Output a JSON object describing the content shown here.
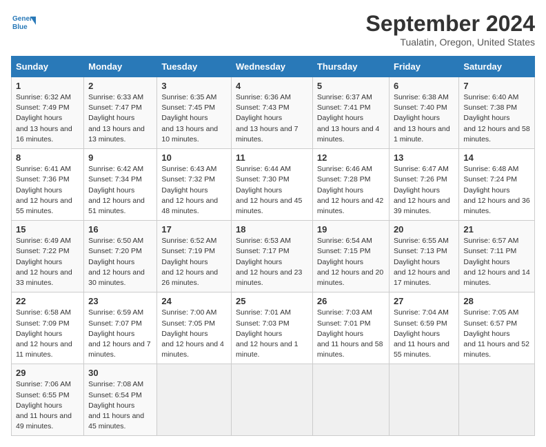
{
  "header": {
    "logo_line1": "General",
    "logo_line2": "Blue",
    "month": "September 2024",
    "location": "Tualatin, Oregon, United States"
  },
  "days_of_week": [
    "Sunday",
    "Monday",
    "Tuesday",
    "Wednesday",
    "Thursday",
    "Friday",
    "Saturday"
  ],
  "weeks": [
    [
      {
        "day": "1",
        "sunrise": "6:32 AM",
        "sunset": "7:49 PM",
        "daylight": "13 hours and 16 minutes."
      },
      {
        "day": "2",
        "sunrise": "6:33 AM",
        "sunset": "7:47 PM",
        "daylight": "13 hours and 13 minutes."
      },
      {
        "day": "3",
        "sunrise": "6:35 AM",
        "sunset": "7:45 PM",
        "daylight": "13 hours and 10 minutes."
      },
      {
        "day": "4",
        "sunrise": "6:36 AM",
        "sunset": "7:43 PM",
        "daylight": "13 hours and 7 minutes."
      },
      {
        "day": "5",
        "sunrise": "6:37 AM",
        "sunset": "7:41 PM",
        "daylight": "13 hours and 4 minutes."
      },
      {
        "day": "6",
        "sunrise": "6:38 AM",
        "sunset": "7:40 PM",
        "daylight": "13 hours and 1 minute."
      },
      {
        "day": "7",
        "sunrise": "6:40 AM",
        "sunset": "7:38 PM",
        "daylight": "12 hours and 58 minutes."
      }
    ],
    [
      {
        "day": "8",
        "sunrise": "6:41 AM",
        "sunset": "7:36 PM",
        "daylight": "12 hours and 55 minutes."
      },
      {
        "day": "9",
        "sunrise": "6:42 AM",
        "sunset": "7:34 PM",
        "daylight": "12 hours and 51 minutes."
      },
      {
        "day": "10",
        "sunrise": "6:43 AM",
        "sunset": "7:32 PM",
        "daylight": "12 hours and 48 minutes."
      },
      {
        "day": "11",
        "sunrise": "6:44 AM",
        "sunset": "7:30 PM",
        "daylight": "12 hours and 45 minutes."
      },
      {
        "day": "12",
        "sunrise": "6:46 AM",
        "sunset": "7:28 PM",
        "daylight": "12 hours and 42 minutes."
      },
      {
        "day": "13",
        "sunrise": "6:47 AM",
        "sunset": "7:26 PM",
        "daylight": "12 hours and 39 minutes."
      },
      {
        "day": "14",
        "sunrise": "6:48 AM",
        "sunset": "7:24 PM",
        "daylight": "12 hours and 36 minutes."
      }
    ],
    [
      {
        "day": "15",
        "sunrise": "6:49 AM",
        "sunset": "7:22 PM",
        "daylight": "12 hours and 33 minutes."
      },
      {
        "day": "16",
        "sunrise": "6:50 AM",
        "sunset": "7:20 PM",
        "daylight": "12 hours and 30 minutes."
      },
      {
        "day": "17",
        "sunrise": "6:52 AM",
        "sunset": "7:19 PM",
        "daylight": "12 hours and 26 minutes."
      },
      {
        "day": "18",
        "sunrise": "6:53 AM",
        "sunset": "7:17 PM",
        "daylight": "12 hours and 23 minutes."
      },
      {
        "day": "19",
        "sunrise": "6:54 AM",
        "sunset": "7:15 PM",
        "daylight": "12 hours and 20 minutes."
      },
      {
        "day": "20",
        "sunrise": "6:55 AM",
        "sunset": "7:13 PM",
        "daylight": "12 hours and 17 minutes."
      },
      {
        "day": "21",
        "sunrise": "6:57 AM",
        "sunset": "7:11 PM",
        "daylight": "12 hours and 14 minutes."
      }
    ],
    [
      {
        "day": "22",
        "sunrise": "6:58 AM",
        "sunset": "7:09 PM",
        "daylight": "12 hours and 11 minutes."
      },
      {
        "day": "23",
        "sunrise": "6:59 AM",
        "sunset": "7:07 PM",
        "daylight": "12 hours and 7 minutes."
      },
      {
        "day": "24",
        "sunrise": "7:00 AM",
        "sunset": "7:05 PM",
        "daylight": "12 hours and 4 minutes."
      },
      {
        "day": "25",
        "sunrise": "7:01 AM",
        "sunset": "7:03 PM",
        "daylight": "12 hours and 1 minute."
      },
      {
        "day": "26",
        "sunrise": "7:03 AM",
        "sunset": "7:01 PM",
        "daylight": "11 hours and 58 minutes."
      },
      {
        "day": "27",
        "sunrise": "7:04 AM",
        "sunset": "6:59 PM",
        "daylight": "11 hours and 55 minutes."
      },
      {
        "day": "28",
        "sunrise": "7:05 AM",
        "sunset": "6:57 PM",
        "daylight": "11 hours and 52 minutes."
      }
    ],
    [
      {
        "day": "29",
        "sunrise": "7:06 AM",
        "sunset": "6:55 PM",
        "daylight": "11 hours and 49 minutes."
      },
      {
        "day": "30",
        "sunrise": "7:08 AM",
        "sunset": "6:54 PM",
        "daylight": "11 hours and 45 minutes."
      },
      null,
      null,
      null,
      null,
      null
    ]
  ]
}
